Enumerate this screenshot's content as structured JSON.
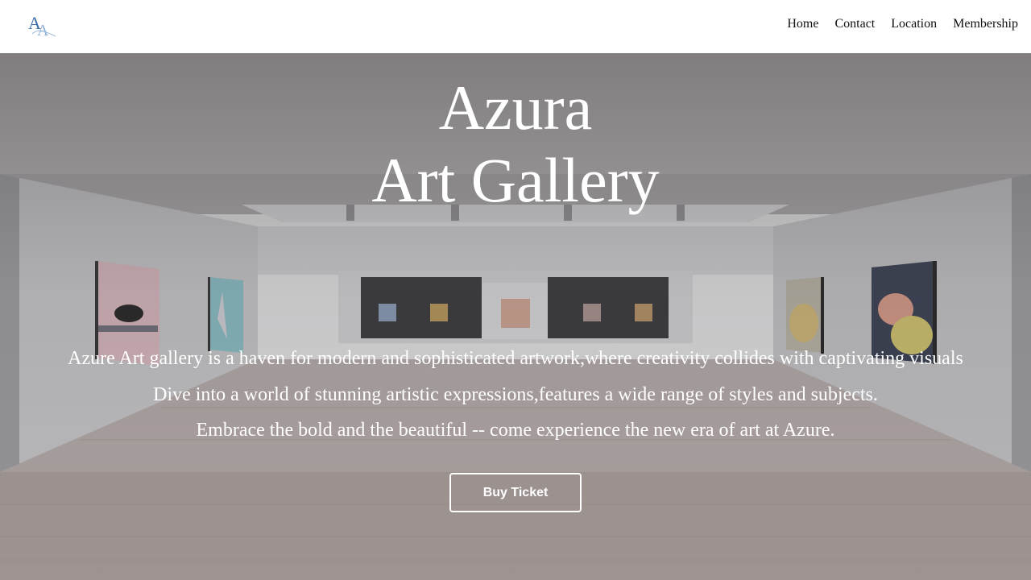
{
  "header": {
    "logo_letters": "AA",
    "nav": [
      "Home",
      "Contact",
      "Location",
      "Membership"
    ]
  },
  "hero": {
    "title_line1": "Azura",
    "title_line2": "Art Gallery",
    "paragraphs": [
      "Azure Art gallery is a haven for modern and sophisticated artwork,where creativity collides with captivating visuals",
      "Dive into a world of stunning artistic expressions,features a wide range of styles and subjects.",
      "Embrace the bold and the beautiful -- come experience the new era of art at Azure."
    ],
    "button_label": "Buy Ticket"
  },
  "colors": {
    "header_bg": "#ffffff",
    "hero_text": "#ffffff",
    "logo_blue": "#3b6fa8"
  }
}
